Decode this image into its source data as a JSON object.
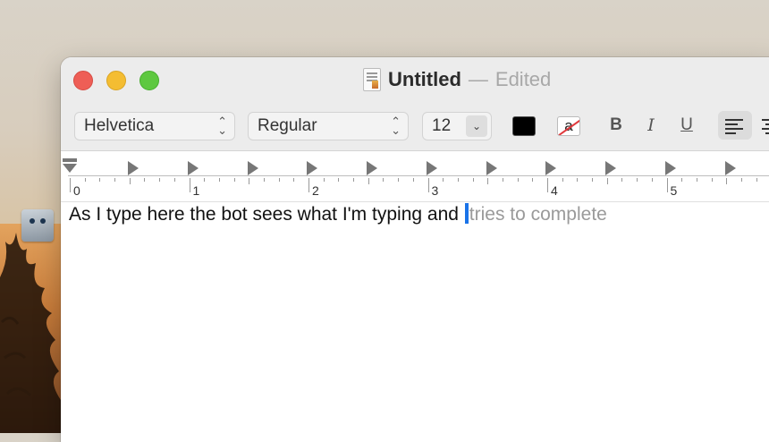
{
  "window": {
    "title": "Untitled",
    "title_separator": "—",
    "status": "Edited"
  },
  "toolbar": {
    "font_family": "Helvetica",
    "font_style": "Regular",
    "font_size": "12",
    "bold_label": "B",
    "italic_label": "I",
    "underline_label": "U",
    "background_color_glyph": "a"
  },
  "ruler": {
    "labels": [
      "0",
      "1",
      "2",
      "3",
      "4",
      "5"
    ]
  },
  "document": {
    "typed_text": "As I type here the bot sees what I'm typing and ",
    "suggestion_text": "tries to complete"
  },
  "colors": {
    "close": "#ee5e56",
    "minimize": "#f4bd32",
    "maximize": "#5ec840",
    "caret": "#1a73e8",
    "suggestion": "#9a9a9a"
  },
  "icons": [
    "desktop-app-icon",
    "document-icon",
    "chevron-updown-icon",
    "align-left-icon",
    "align-center-icon"
  ]
}
